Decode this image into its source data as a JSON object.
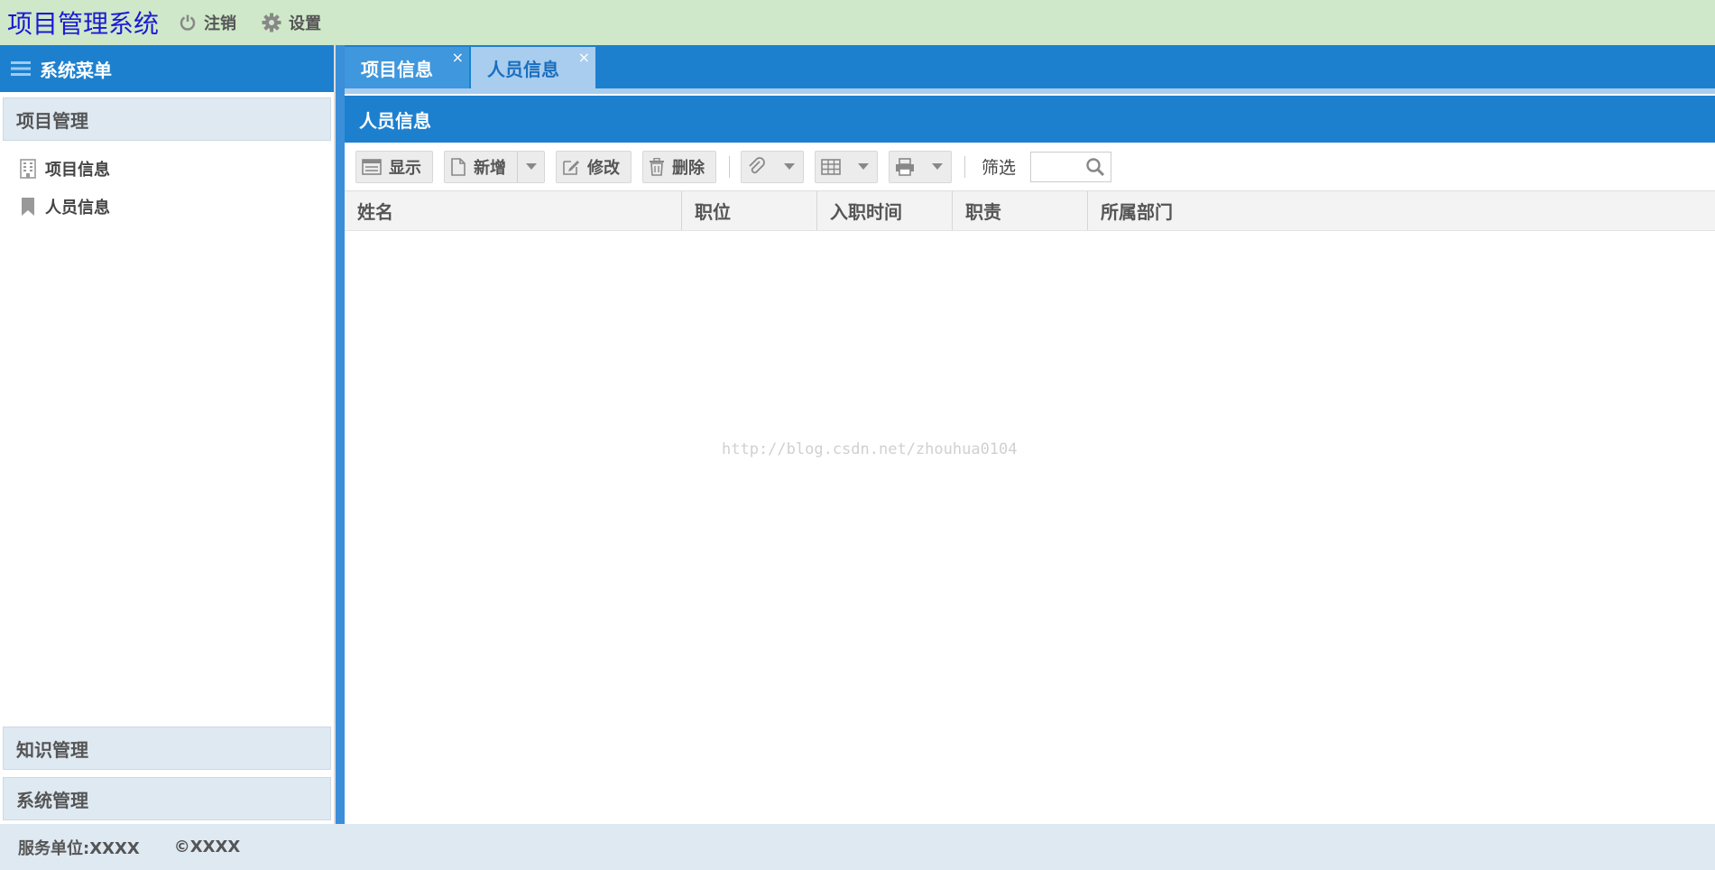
{
  "header": {
    "app_title": "项目管理系统",
    "logout_label": "注销",
    "settings_label": "设置"
  },
  "sidebar": {
    "title": "系统菜单",
    "groups": [
      {
        "label": "项目管理",
        "items": [
          {
            "label": "项目信息",
            "icon": "building-icon"
          },
          {
            "label": "人员信息",
            "icon": "bookmark-icon"
          }
        ]
      },
      {
        "label": "知识管理"
      },
      {
        "label": "系统管理"
      }
    ]
  },
  "tabs": [
    {
      "label": "项目信息",
      "close": "×",
      "active": false
    },
    {
      "label": "人员信息",
      "close": "×",
      "active": true
    }
  ],
  "panel": {
    "title": "人员信息"
  },
  "toolbar": {
    "show_label": "显示",
    "add_label": "新增",
    "edit_label": "修改",
    "delete_label": "删除",
    "filter_label": "筛选",
    "filter_value": ""
  },
  "grid": {
    "columns": [
      "姓名",
      "职位",
      "入职时间",
      "职责",
      "所属部门"
    ],
    "rows": []
  },
  "watermark": "http://blog.csdn.net/zhouhua0104",
  "footer": {
    "service_unit": "服务单位:XXXX",
    "copyright": "©XXXX"
  },
  "colors": {
    "topbar": "#cfe8c9",
    "primary": "#1d80cf",
    "title": "#1a1ad6"
  }
}
